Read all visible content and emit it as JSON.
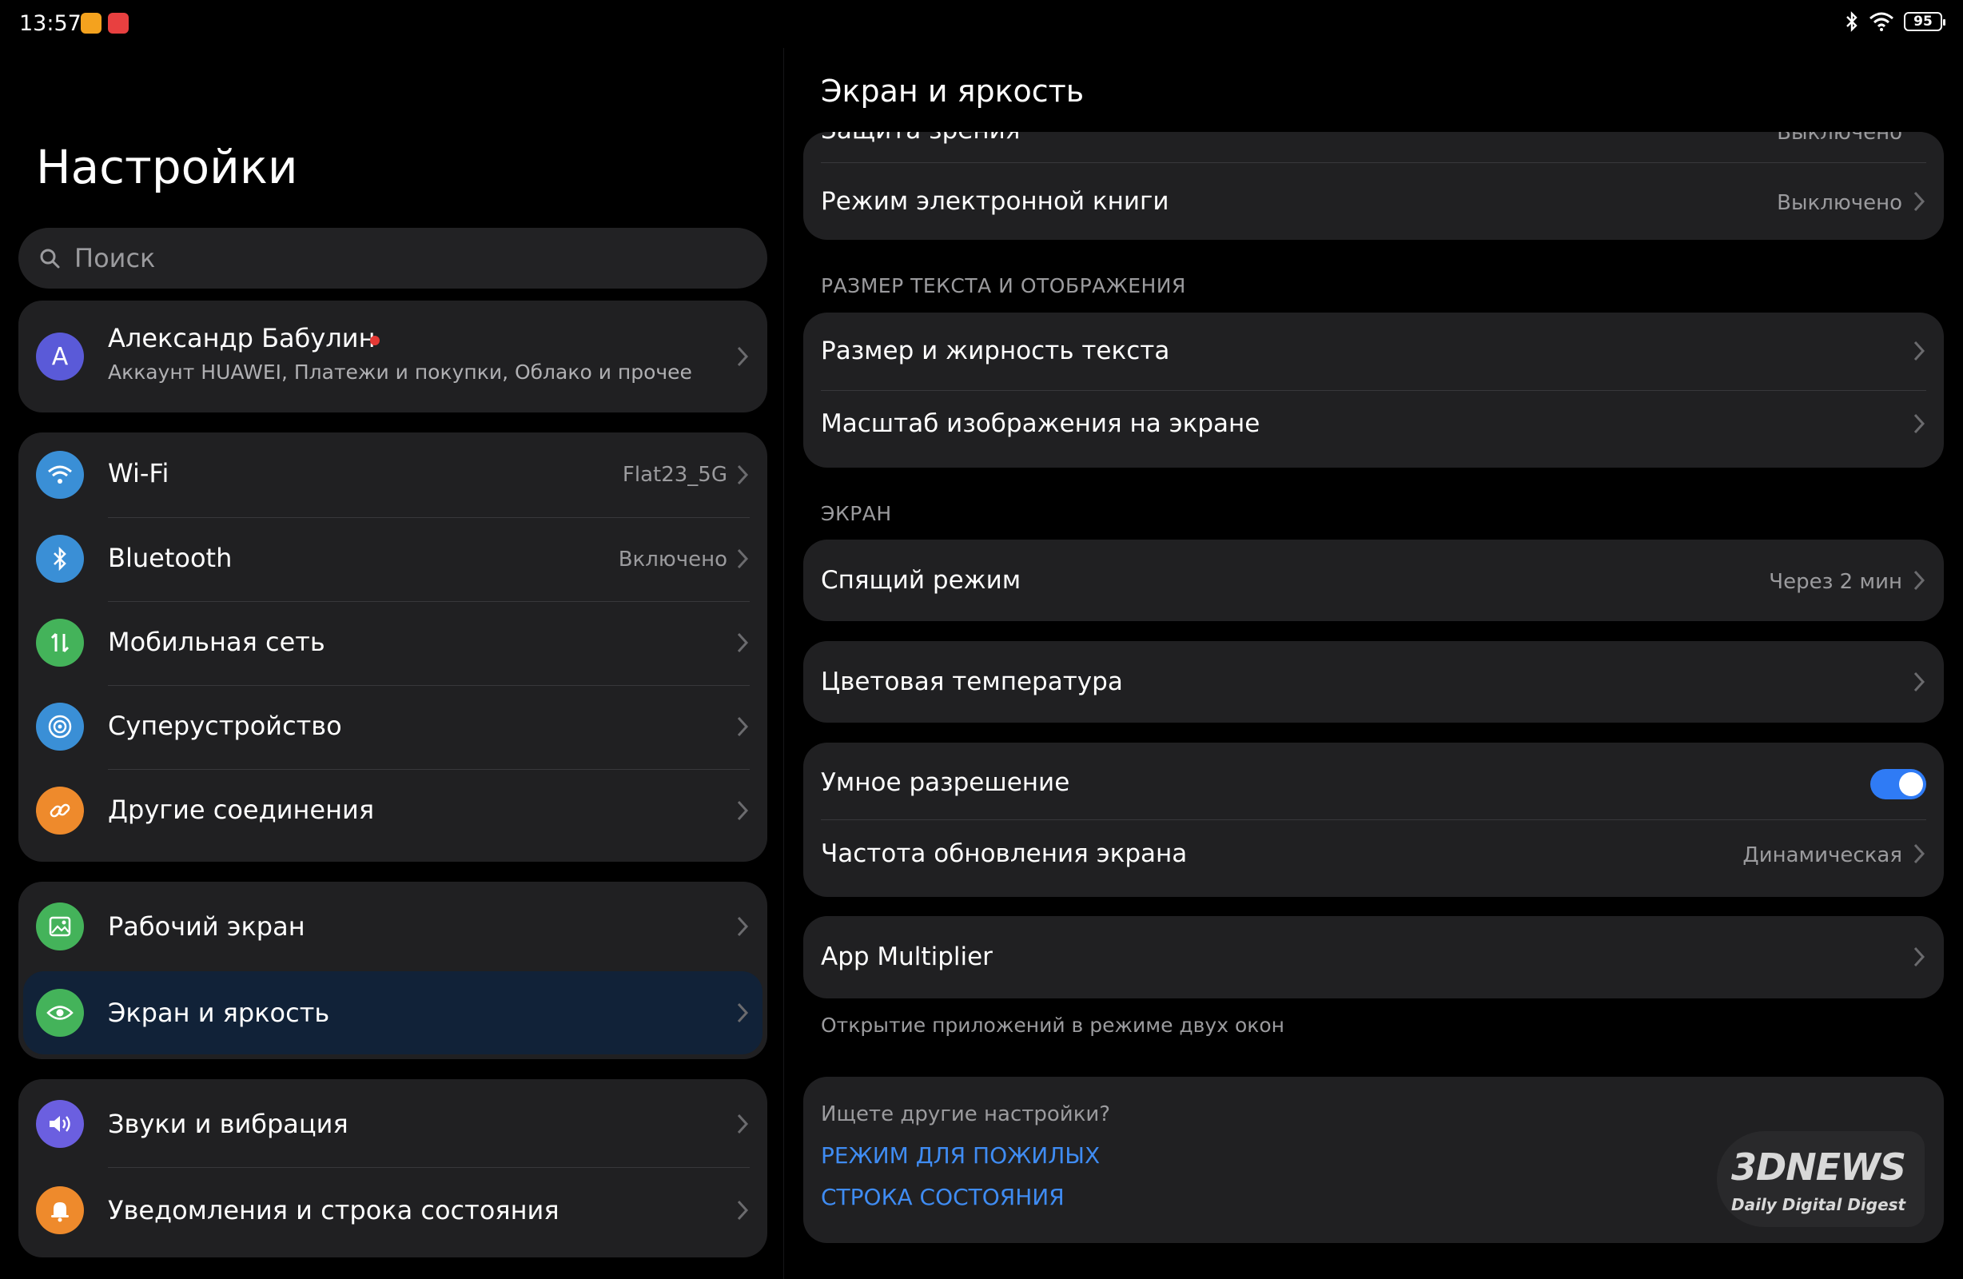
{
  "status_bar": {
    "time": "13:57",
    "battery": "95"
  },
  "left": {
    "title": "Настройки",
    "search_placeholder": "Поиск",
    "account": {
      "avatar_letter": "А",
      "name": "Александр Бабулин",
      "subtitle": "Аккаунт HUAWEI, Платежи и покупки, Облако и прочее"
    },
    "connections": [
      {
        "label": "Wi-Fi",
        "value": "Flat23_5G"
      },
      {
        "label": "Bluetooth",
        "value": "Включено"
      },
      {
        "label": "Мобильная сеть",
        "value": ""
      },
      {
        "label": "Суперустройство",
        "value": ""
      },
      {
        "label": "Другие соединения",
        "value": ""
      }
    ],
    "display_group": [
      {
        "label": "Рабочий экран"
      },
      {
        "label": "Экран и яркость"
      }
    ],
    "sound_group": [
      {
        "label": "Звуки и вибрация"
      },
      {
        "label": "Уведомления и строка состояния"
      }
    ]
  },
  "right": {
    "title": "Экран и яркость",
    "top_card": {
      "partial_label": "Защита зрения",
      "partial_value": "Выключено",
      "ebook_label": "Режим электронной книги",
      "ebook_value": "Выключено"
    },
    "section_text_size": "РАЗМЕР ТЕКСТА И ОТОБРАЖЕНИЯ",
    "text_size_items": [
      {
        "label": "Размер и жирность текста"
      },
      {
        "label": "Масштаб изображения на экране"
      }
    ],
    "section_screen": "ЭКРАН",
    "sleep": {
      "label": "Спящий режим",
      "value": "Через 2 мин"
    },
    "color_temp": {
      "label": "Цветовая температура"
    },
    "smart_resolution": {
      "label": "Умное разрешение",
      "enabled": true
    },
    "refresh_rate": {
      "label": "Частота обновления экрана",
      "value": "Динамическая"
    },
    "app_multiplier": {
      "label": "App Multiplier",
      "note": "Открытие приложений в режиме двух окон"
    },
    "looking_for": {
      "title": "Ищете другие настройки?",
      "links": [
        "РЕЖИМ ДЛЯ ПОЖИЛЫХ",
        "СТРОКА СОСТОЯНИЯ"
      ]
    },
    "watermark": {
      "brand": "3DNEWS",
      "tagline": "Daily Digital Digest"
    }
  },
  "colors": {
    "accent": "#2f7bf5",
    "card": "#202022",
    "wifi_icon": "#3a8fd6",
    "bluetooth_icon": "#3a8fd6",
    "mobile_icon": "#44b35a",
    "superdevice_icon": "#3a8fd6",
    "other_conn_icon": "#ee8a2c",
    "home_icon": "#44b35a",
    "display_icon": "#44b35a",
    "sound_icon": "#6b5fe0",
    "notif_icon": "#ee8a2c",
    "avatar": "#5a5ad8"
  }
}
